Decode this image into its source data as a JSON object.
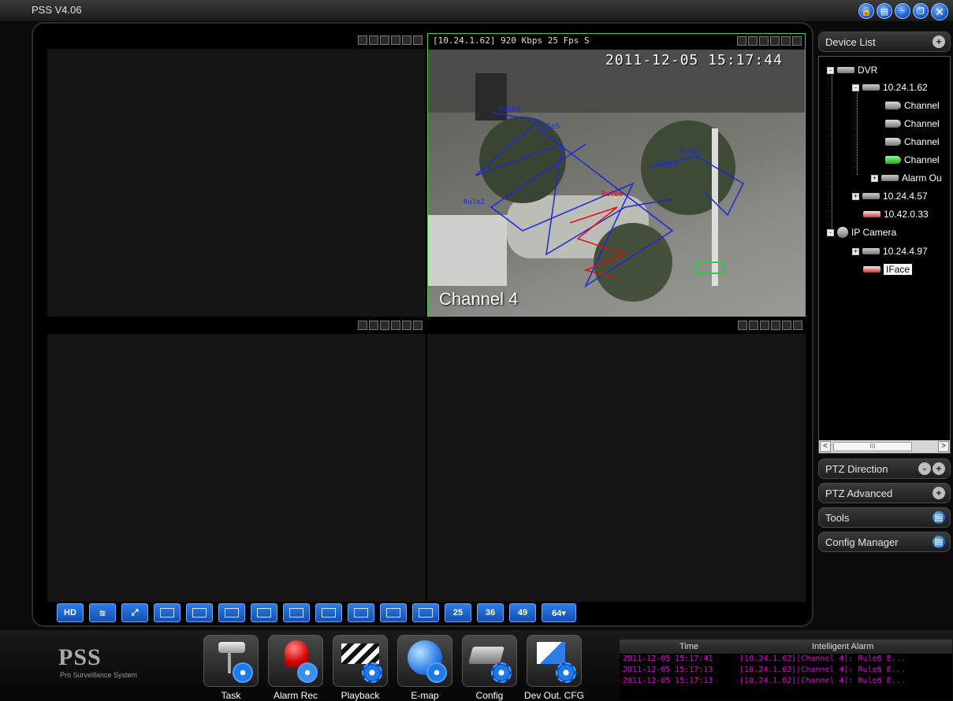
{
  "app": {
    "title": "PSS  V4.06"
  },
  "window_buttons": [
    "lock",
    "list",
    "minimize",
    "restore",
    "close"
  ],
  "video": {
    "active_pane": {
      "info": "[10.24.1.62]  920 Kbps 25 Fps S",
      "timestamp": "2011-12-05  15:17:44",
      "channel_label": "Channel 4",
      "rules": [
        "Rule4",
        "Rule5",
        "Rule3",
        "Rule1",
        "Rule2",
        "Rule6"
      ]
    }
  },
  "layout_buttons": [
    "HD",
    "",
    "",
    "",
    "",
    "",
    "",
    "",
    "",
    "",
    "",
    "",
    "25",
    "36",
    "49",
    "64▾"
  ],
  "right_panel": {
    "device_list": "Device List",
    "tree": {
      "dvr": "DVR",
      "dev1": "10.24.1.62",
      "channels": [
        "Channel",
        "Channel",
        "Channel",
        "Channel"
      ],
      "alarm_out": "Alarm Ou",
      "dev2": "10.24.4.57",
      "dev3": "10.42.0.33",
      "ipcam": "IP Camera",
      "dev4": "10.24.4.97",
      "iface": "IFace",
      "scroll_thumb": "III"
    },
    "ptz_direction": "PTZ Direction",
    "ptz_advanced": "PTZ Advanced",
    "tools": "Tools",
    "config_manager": "Config Manager"
  },
  "brand": {
    "logo": "PSS",
    "tagline": "Pro Surveillance System"
  },
  "apps": [
    "Task",
    "Alarm Rec",
    "Playback",
    "E-map",
    "Config",
    "Dev Out. CFG"
  ],
  "alarm": {
    "col_time": "Time",
    "col_alarm": "Intelligent Alarm",
    "rows": [
      {
        "time": "2011-12-05 15:17:41",
        "msg": "[10.24.1.62][Channel 4]: Rule6 E..."
      },
      {
        "time": "2011-12-05 15:17:13",
        "msg": "[10.24.1.62][Channel 4]: Rule6 E..."
      },
      {
        "time": "2011-12-05 15:17:13",
        "msg": "[10.24.1.62][Channel 4]: Rule6 E..."
      }
    ]
  }
}
